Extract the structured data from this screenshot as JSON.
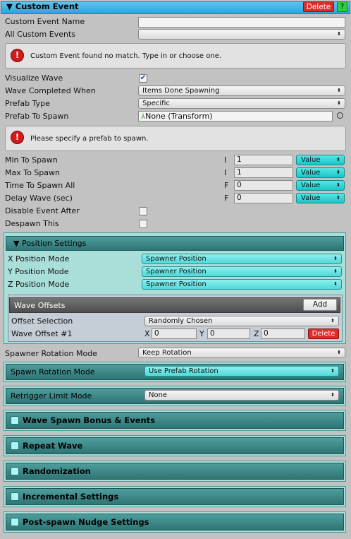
{
  "header": {
    "title": "▼ Custom Event",
    "delete_label": "Delete",
    "help_label": "?"
  },
  "fields": {
    "custom_event_name": {
      "label": "Custom Event Name",
      "value": ""
    },
    "all_custom_events": {
      "label": "All Custom Events",
      "value": ""
    },
    "warning_custom_event": "Custom Event found no match. Type in or choose one.",
    "visualize_wave": {
      "label": "Visualize Wave",
      "checked": true
    },
    "wave_completed_when": {
      "label": "Wave Completed When",
      "value": "Items Done Spawning"
    },
    "prefab_type": {
      "label": "Prefab Type",
      "value": "Specific"
    },
    "prefab_to_spawn": {
      "label": "Prefab To Spawn",
      "value": "None (Transform)"
    },
    "warning_prefab": "Please specify a prefab to spawn.",
    "min_to_spawn": {
      "label": "Min To Spawn",
      "type": "I",
      "value": "1",
      "mode": "Value"
    },
    "max_to_spawn": {
      "label": "Max To Spawn",
      "type": "I",
      "value": "1",
      "mode": "Value"
    },
    "time_to_spawn_all": {
      "label": "Time To Spawn All",
      "type": "F",
      "value": "0",
      "mode": "Value"
    },
    "delay_wave": {
      "label": "Delay Wave (sec)",
      "type": "F",
      "value": "0",
      "mode": "Value"
    },
    "disable_event_after": {
      "label": "Disable Event After",
      "checked": false
    },
    "despawn_this": {
      "label": "Despawn This",
      "checked": false
    }
  },
  "position_settings": {
    "title": "▼ Position Settings",
    "x_mode": {
      "label": "X Position Mode",
      "value": "Spawner Position"
    },
    "y_mode": {
      "label": "Y Position Mode",
      "value": "Spawner Position"
    },
    "z_mode": {
      "label": "Z Position Mode",
      "value": "Spawner Position"
    },
    "wave_offsets": {
      "title": "Wave Offsets",
      "add_label": "Add",
      "offset_selection": {
        "label": "Offset Selection",
        "value": "Randomly Chosen"
      },
      "offset_1": {
        "label": "Wave Offset #1",
        "x_label": "X",
        "x": "0",
        "y_label": "Y",
        "y": "0",
        "z_label": "Z",
        "z": "0",
        "delete_label": "Delete"
      }
    }
  },
  "spawner_rotation": {
    "label": "Spawner Rotation Mode",
    "value": "Keep Rotation"
  },
  "spawn_rotation": {
    "label": "Spawn Rotation Mode",
    "value": "Use Prefab Rotation"
  },
  "retrigger_limit": {
    "label": "Retrigger Limit Mode",
    "value": "None"
  },
  "sections": [
    {
      "title": "Wave Spawn Bonus & Events"
    },
    {
      "title": "Repeat Wave"
    },
    {
      "title": "Randomization"
    },
    {
      "title": "Incremental Settings"
    },
    {
      "title": "Post-spawn Nudge Settings"
    }
  ],
  "colors": {
    "header_blue": "#2fa3d9",
    "teal_bar": "#2f7575",
    "teal_panel": "#aadfd9",
    "value_cyan": "#19c6c6",
    "delete_red": "#e02b2b"
  }
}
